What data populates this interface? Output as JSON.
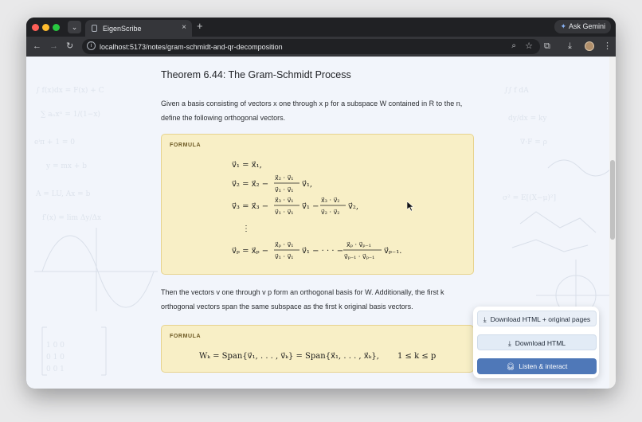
{
  "browser": {
    "tab_title": "EigenScribe",
    "tab_search_icon": "chevron-down-icon",
    "tab_close": "×",
    "new_tab": "+",
    "gemini_label": "Ask Gemini",
    "url": "localhost:5173/notes/gram-schmidt-and-qr-decomposition"
  },
  "page": {
    "theorem_title": "Theorem 6.44: The Gram-Schmidt Process",
    "intro_line1": "Given a basis consisting of vectors x one through x p for a subspace W contained in R to the n,",
    "intro_line2": "define the following orthogonal vectors.",
    "formula1_label": "FORMULA",
    "result_line1": "Then the vectors v one through v p form an orthogonal basis for W. Additionally, the first k",
    "result_line2": "orthogonal vectors span the same subspace as the first k original basis vectors.",
    "formula2_label": "FORMULA"
  },
  "popup": {
    "download_html_original": "Download HTML + original pages",
    "download_html": "Download HTML",
    "listen": "Listen & interact"
  },
  "colors": {
    "formula_bg": "#f8efc6",
    "formula_border": "#e7d38e",
    "accent_button": "#4f78b8"
  }
}
